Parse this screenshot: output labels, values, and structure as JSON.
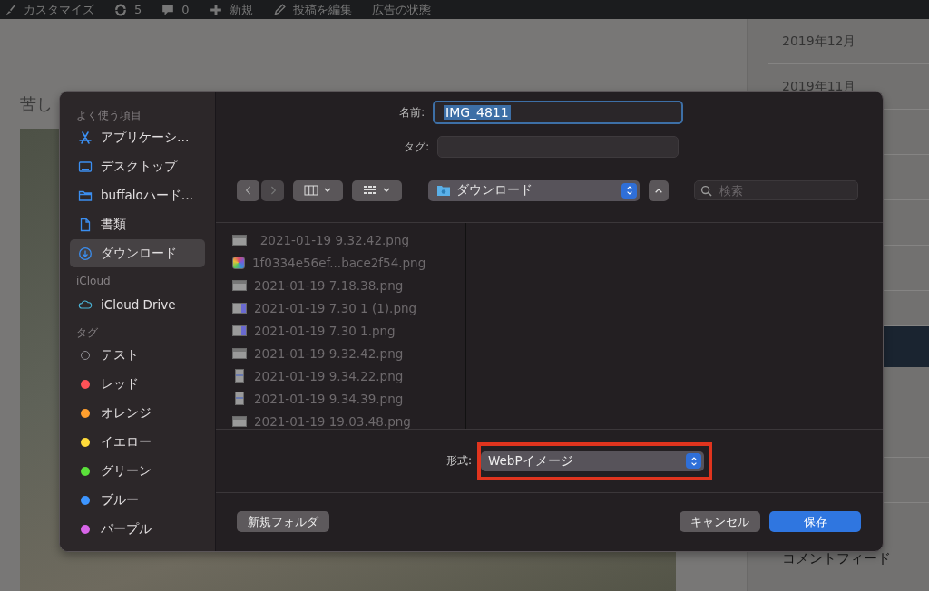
{
  "admin_bar": {
    "items": [
      {
        "kind": "brush",
        "label": "カスタマイズ"
      },
      {
        "kind": "refresh",
        "label": "5"
      },
      {
        "kind": "comment",
        "label": "0"
      },
      {
        "kind": "plus",
        "label": "新規"
      },
      {
        "kind": "pencil",
        "label": "投稿を編集"
      },
      {
        "kind": "text",
        "label": "広告の状態"
      }
    ]
  },
  "article": {
    "heading": "苦し"
  },
  "archive_sidebar": {
    "items": [
      "2019年12月",
      "2019年11月"
    ],
    "footer_link": "コメントフィード"
  },
  "dialog": {
    "sidebar": {
      "sections": [
        {
          "title": "よく使う項目",
          "items": [
            {
              "kind": "apps",
              "label": "アプリケーシ…",
              "selected": false
            },
            {
              "kind": "desktop",
              "label": "デスクトップ",
              "selected": false
            },
            {
              "kind": "folder",
              "label": "buffaloハード…",
              "selected": false
            },
            {
              "kind": "document",
              "label": "書類",
              "selected": false
            },
            {
              "kind": "download",
              "label": "ダウンロード",
              "selected": true
            }
          ]
        },
        {
          "title": "iCloud",
          "items": [
            {
              "kind": "cloud",
              "label": "iCloud Drive",
              "selected": false
            }
          ]
        },
        {
          "title": "タグ",
          "items": [
            {
              "kind": "tag-outline",
              "color": "#8e8e93",
              "label": "テスト",
              "selected": false
            },
            {
              "kind": "tag",
              "color": "#ff5257",
              "label": "レッド",
              "selected": false
            },
            {
              "kind": "tag",
              "color": "#ff9f2e",
              "label": "オレンジ",
              "selected": false
            },
            {
              "kind": "tag",
              "color": "#ffdb3a",
              "label": "イエロー",
              "selected": false
            },
            {
              "kind": "tag",
              "color": "#5be13a",
              "label": "グリーン",
              "selected": false
            },
            {
              "kind": "tag",
              "color": "#3d95ff",
              "label": "ブルー",
              "selected": false
            },
            {
              "kind": "tag",
              "color": "#d865e8",
              "label": "パープル",
              "selected": false
            }
          ]
        }
      ]
    },
    "name_label": "名前:",
    "name_value": "IMG_4811",
    "tags_label": "タグ:",
    "location": "ダウンロード",
    "search": {
      "placeholder": "検索"
    },
    "files": [
      {
        "kind": "screenshot",
        "name": "_2021-01-19 9.32.42.png",
        "disabled": true
      },
      {
        "kind": "colorful",
        "name": "1f0334e56ef...bace2f54.png",
        "disabled": true
      },
      {
        "kind": "screenshot",
        "name": "2021-01-19 7.18.38.png",
        "disabled": true
      },
      {
        "kind": "window",
        "name": "2021-01-19 7.30 1 (1).png",
        "disabled": true
      },
      {
        "kind": "window",
        "name": "2021-01-19 7.30 1.png",
        "disabled": true
      },
      {
        "kind": "screenshot",
        "name": "2021-01-19 9.32.42.png",
        "disabled": true
      },
      {
        "kind": "page",
        "name": "2021-01-19 9.34.22.png",
        "disabled": true
      },
      {
        "kind": "page",
        "name": "2021-01-19 9.34.39.png",
        "disabled": true
      },
      {
        "kind": "screenshot",
        "name": "2021-01-19 19.03.48.png",
        "disabled": true
      }
    ],
    "format": {
      "label": "形式:",
      "value": "WebPイメージ",
      "highlighted": true
    },
    "buttons": [
      {
        "kind": "secondary",
        "label": "新規フォルダ"
      },
      {
        "kind": "secondary",
        "label": "キャンセル"
      },
      {
        "kind": "primary",
        "label": "保存"
      }
    ]
  }
}
